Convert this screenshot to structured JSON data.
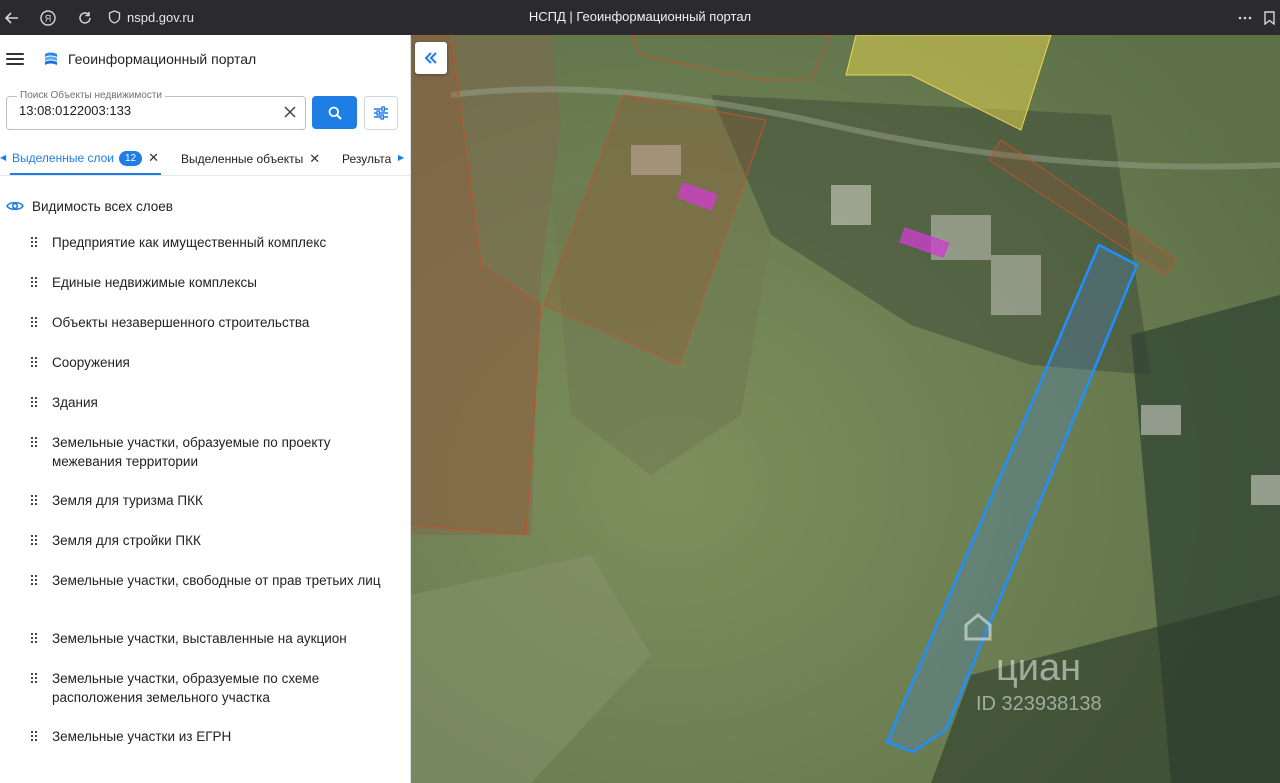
{
  "browser": {
    "url": "nspd.gov.ru",
    "tab_title": "НСПД | Геоинформационный портал"
  },
  "sidebar": {
    "portal_title": "Геоинформационный портал",
    "search": {
      "label": "Поиск Объекты недвижимости",
      "value": "13:08:0122003:133"
    },
    "tabs": [
      {
        "label": "Выделенные слои",
        "badge": "12",
        "active": true
      },
      {
        "label": "Выделенные объекты",
        "active": false
      },
      {
        "label": "Результа",
        "active": false
      }
    ],
    "visibility_label": "Видимость всех слоев",
    "layers": [
      "Предприятие как имущественный комплекс",
      "Единые недвижимые комплексы",
      "Объекты незавершенного строительства",
      "Сооружения",
      "Здания",
      "Земельные участки, образуемые по проекту межевания территории",
      "Земля для туризма ПКК",
      "Земля для стройки ПКК",
      "Земельные участки, свободные от прав третьих лиц",
      "Земельные участки, выставленные на аукцион",
      "Земельные участки, образуемые по схеме расположения земельного участка",
      "Земельные участки из ЕГРН"
    ]
  },
  "map": {
    "watermark": "циан",
    "watermark_id": "ID 323938138",
    "colors": {
      "selected_parcel": "#1e90ff",
      "parcel_border": "#c0532e",
      "building": "#d03cd0",
      "zone": "#e8d850"
    }
  },
  "icons": {
    "back": "arrow-left-icon",
    "yandex": "yandex-icon",
    "reload": "reload-icon",
    "shield": "shield-icon",
    "more": "more-icon",
    "bookmark": "bookmark-icon",
    "menu": "menu-icon",
    "search": "search-icon",
    "filter": "filter-icon",
    "clear": "close-icon",
    "eye": "eye-icon",
    "collapse": "double-chevron-left-icon"
  }
}
